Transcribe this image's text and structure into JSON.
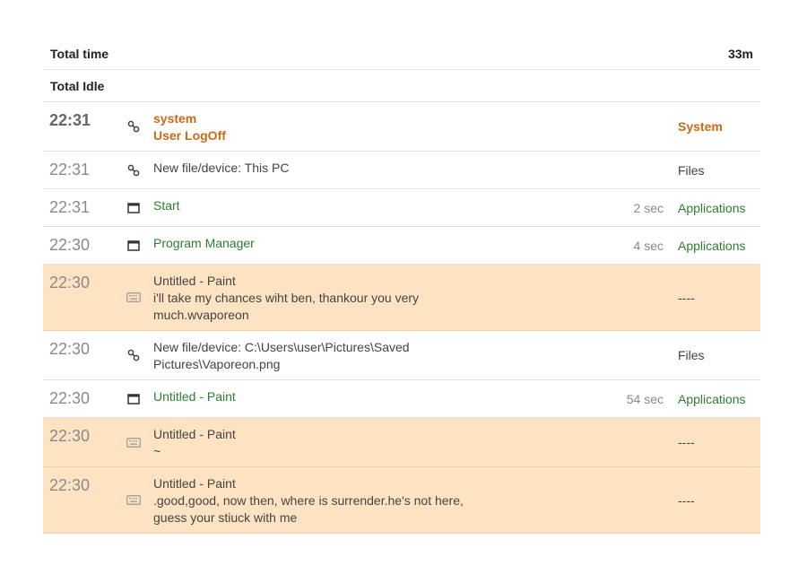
{
  "summary": {
    "total_time_label": "Total time",
    "total_time_value": "33m",
    "total_idle_label": "Total Idle",
    "total_idle_value": ""
  },
  "entries": [
    {
      "time": "22:31",
      "icon": "link-icon",
      "line1": "system",
      "line2": "User LogOff",
      "duration": "",
      "category": "System"
    },
    {
      "time": "22:31",
      "icon": "link-icon",
      "line1": "New file/device: This PC",
      "line2": "",
      "duration": "",
      "category": "Files"
    },
    {
      "time": "22:31",
      "icon": "window-icon",
      "line1": "Start",
      "line2": "",
      "duration": "2 sec",
      "category": "Applications"
    },
    {
      "time": "22:30",
      "icon": "window-icon",
      "line1": "Program Manager",
      "line2": "",
      "duration": "4 sec",
      "category": "Applications"
    },
    {
      "time": "22:30",
      "icon": "keyboard-icon",
      "line1": "Untitled - Paint",
      "line2": "i'll take my chances wiht ben, thankour you very",
      "line3": "much.wvaporeon",
      "duration": "",
      "category": "----"
    },
    {
      "time": "22:30",
      "icon": "link-icon",
      "line1": "New file/device: C:\\Users\\user\\Pictures\\Saved",
      "line2": "Pictures\\Vaporeon.png",
      "duration": "",
      "category": "Files"
    },
    {
      "time": "22:30",
      "icon": "window-icon",
      "line1": "Untitled - Paint",
      "line2": "",
      "duration": "54 sec",
      "category": "Applications"
    },
    {
      "time": "22:30",
      "icon": "keyboard-icon",
      "line1": "Untitled - Paint",
      "line2": "~",
      "duration": "",
      "category": "----"
    },
    {
      "time": "22:30",
      "icon": "keyboard-icon",
      "line1": "Untitled - Paint",
      "line2": ".good,good, now then, where is surrender.he's not here,",
      "line3": "guess your stiuck with me",
      "duration": "",
      "category": "----"
    }
  ],
  "colors": {
    "green": "#2e7d32",
    "orange": "#c96a18",
    "highlight": "#fde3c2"
  }
}
